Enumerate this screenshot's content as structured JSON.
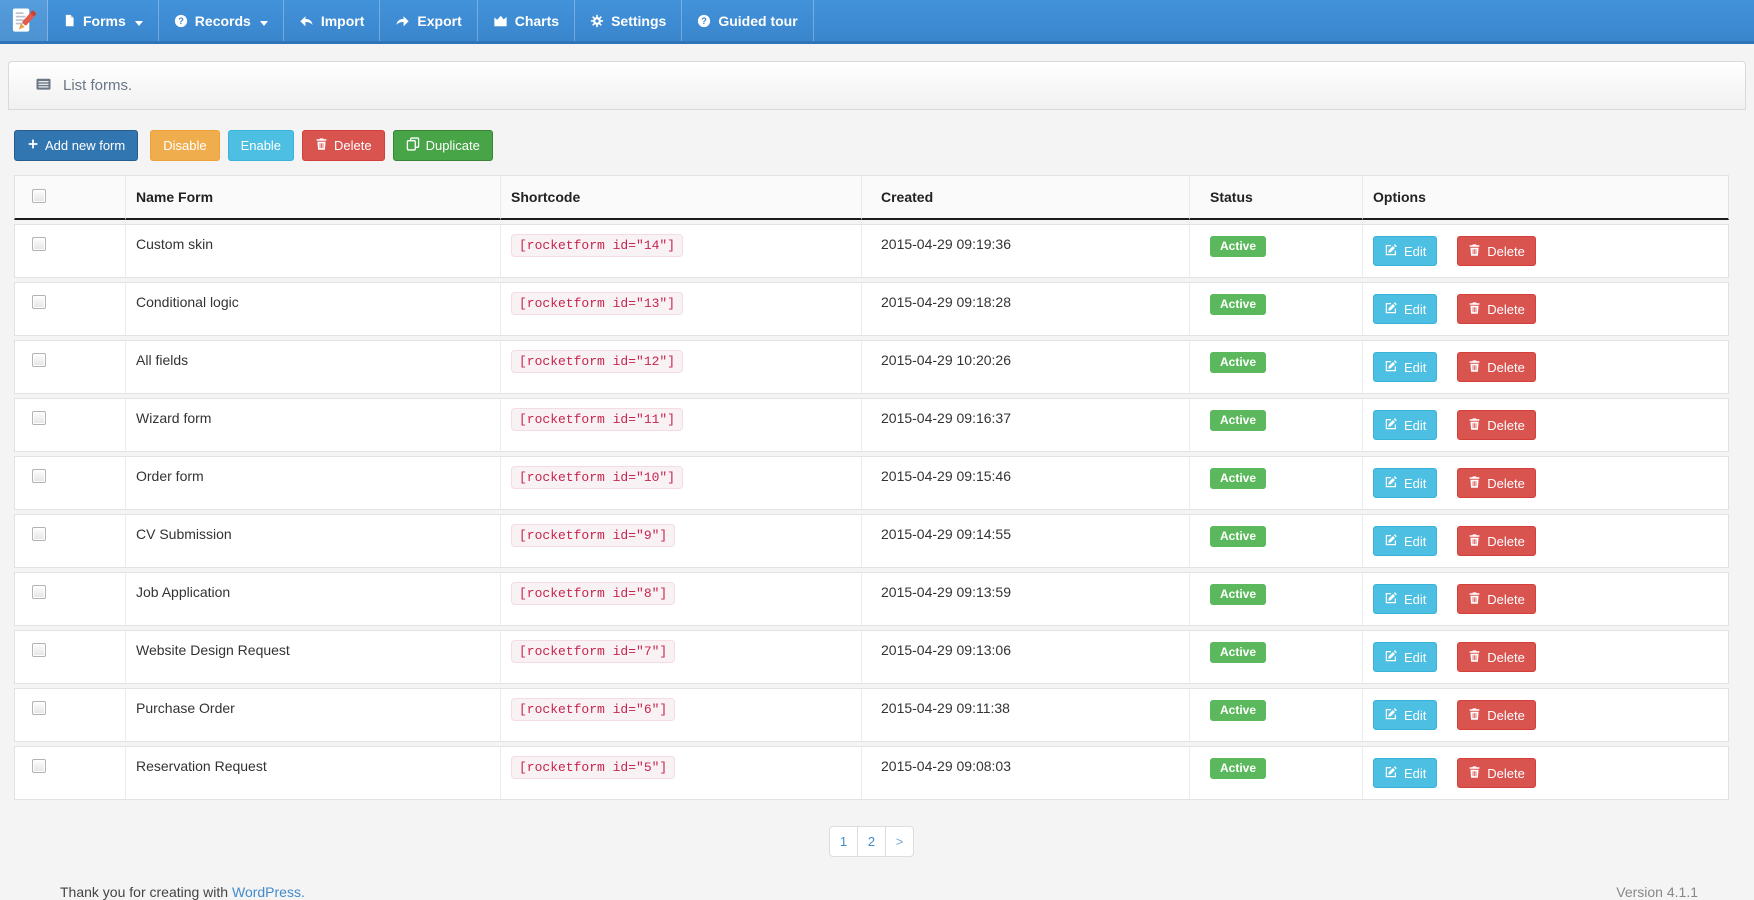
{
  "nav": {
    "logo_icon": "rocketform-logo-icon",
    "items": [
      {
        "label": "Forms",
        "icon": "file-icon",
        "has_caret": true
      },
      {
        "label": "Records",
        "icon": "question-circle-icon",
        "has_caret": true
      },
      {
        "label": "Import",
        "icon": "reply-arrow-icon"
      },
      {
        "label": "Export",
        "icon": "share-arrow-icon"
      },
      {
        "label": "Charts",
        "icon": "area-chart-icon"
      },
      {
        "label": "Settings",
        "icon": "gear-icon"
      },
      {
        "label": "Guided tour",
        "icon": "question-circle-icon"
      }
    ]
  },
  "panel": {
    "title": "List forms.",
    "icon": "list-icon"
  },
  "toolbar": {
    "add_label": "Add new form",
    "disable_label": "Disable",
    "enable_label": "Enable",
    "delete_label": "Delete",
    "duplicate_label": "Duplicate"
  },
  "table": {
    "headers": {
      "name": "Name Form",
      "shortcode": "Shortcode",
      "created": "Created",
      "status": "Status",
      "options": "Options"
    },
    "edit_label": "Edit",
    "delete_label": "Delete",
    "rows": [
      {
        "name": "Custom skin",
        "shortcode": "[rocketform id=\"14\"]",
        "created": "2015-04-29 09:19:36",
        "status": "Active"
      },
      {
        "name": "Conditional logic",
        "shortcode": "[rocketform id=\"13\"]",
        "created": "2015-04-29 09:18:28",
        "status": "Active"
      },
      {
        "name": "All fields",
        "shortcode": "[rocketform id=\"12\"]",
        "created": "2015-04-29 10:20:26",
        "status": "Active"
      },
      {
        "name": "Wizard form",
        "shortcode": "[rocketform id=\"11\"]",
        "created": "2015-04-29 09:16:37",
        "status": "Active"
      },
      {
        "name": "Order form",
        "shortcode": "[rocketform id=\"10\"]",
        "created": "2015-04-29 09:15:46",
        "status": "Active"
      },
      {
        "name": "CV Submission",
        "shortcode": "[rocketform id=\"9\"]",
        "created": "2015-04-29 09:14:55",
        "status": "Active"
      },
      {
        "name": "Job Application",
        "shortcode": "[rocketform id=\"8\"]",
        "created": "2015-04-29 09:13:59",
        "status": "Active"
      },
      {
        "name": "Website Design Request",
        "shortcode": "[rocketform id=\"7\"]",
        "created": "2015-04-29 09:13:06",
        "status": "Active"
      },
      {
        "name": "Purchase Order",
        "shortcode": "[rocketform id=\"6\"]",
        "created": "2015-04-29 09:11:38",
        "status": "Active"
      },
      {
        "name": "Reservation Request",
        "shortcode": "[rocketform id=\"5\"]",
        "created": "2015-04-29 09:08:03",
        "status": "Active"
      }
    ]
  },
  "pagination": {
    "pages": [
      "1",
      "2",
      ">"
    ]
  },
  "footer": {
    "left_prefix": "Thank you for creating with ",
    "left_link": "WordPress.",
    "right": "Version 4.1.1"
  },
  "colors": {
    "navbar_blue": "#3a86cd",
    "primary": "#3276b1",
    "warning": "#f0ad4e",
    "info": "#4cbfe2",
    "danger": "#d9534f",
    "success": "#47a447",
    "shortcode_text": "#c7254e",
    "shortcode_bg": "#f9f2f4",
    "badge_active": "#5cb85c",
    "link": "#428bca"
  }
}
